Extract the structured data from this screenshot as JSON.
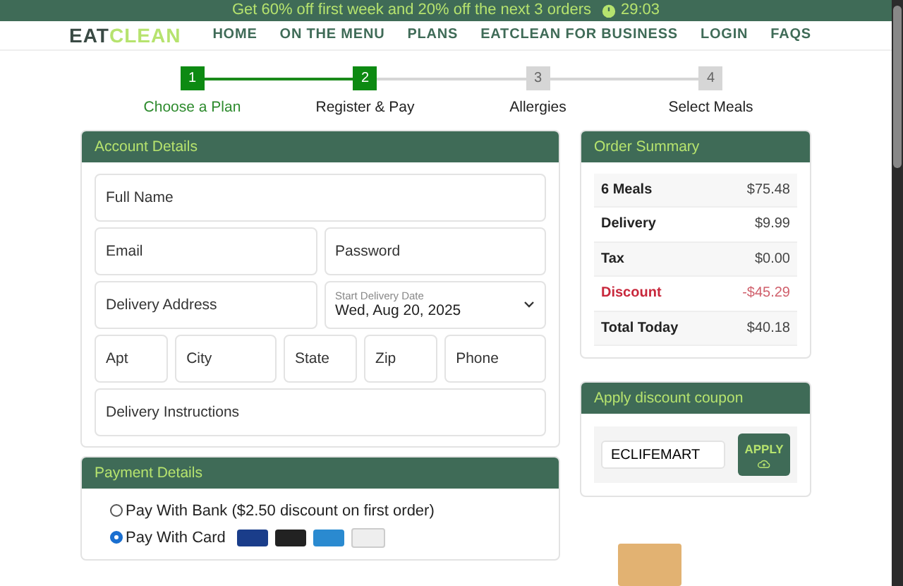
{
  "banner": {
    "text": "Get 60% off first week and 20% off the next 3 orders",
    "timer": "29:03"
  },
  "nav": {
    "logo_dark": "EAT",
    "logo_light": "CLEAN",
    "items": [
      "HOME",
      "ON THE MENU",
      "PLANS",
      "EATCLEAN FOR BUSINESS",
      "LOGIN",
      "FAQS"
    ]
  },
  "steps": [
    {
      "number": "1",
      "label": "Choose a Plan",
      "reached": true,
      "completed": true
    },
    {
      "number": "2",
      "label": "Register & Pay",
      "reached": true,
      "completed": false
    },
    {
      "number": "3",
      "label": "Allergies",
      "reached": false,
      "completed": false
    },
    {
      "number": "4",
      "label": "Select Meals",
      "reached": false,
      "completed": false
    }
  ],
  "account": {
    "title": "Account Details",
    "rows": [
      [
        {
          "kind": "text",
          "placeholder": "Full Name"
        }
      ],
      [
        {
          "kind": "text",
          "placeholder": "Email"
        },
        {
          "kind": "text",
          "placeholder": "Password"
        }
      ],
      [
        {
          "kind": "text",
          "placeholder": "Delivery Address"
        },
        {
          "kind": "select",
          "label": "Start Delivery Date",
          "value": "Wed, Aug 20, 2025"
        }
      ],
      [
        {
          "kind": "text",
          "placeholder": "Apt"
        },
        {
          "kind": "text",
          "placeholder": "City"
        },
        {
          "kind": "text",
          "placeholder": "State"
        },
        {
          "kind": "text",
          "placeholder": "Zip"
        },
        {
          "kind": "text",
          "placeholder": "Phone"
        }
      ],
      [
        {
          "kind": "text",
          "placeholder": "Delivery Instructions"
        }
      ]
    ]
  },
  "payment": {
    "title": "Payment Details",
    "options": [
      {
        "label": "Pay With Bank ($2.50 discount on first order)",
        "selected": false
      },
      {
        "label": "Pay With Card",
        "selected": true
      }
    ]
  },
  "summary": {
    "title": "Order Summary",
    "rows": [
      {
        "label": "6 Meals",
        "amount": "$75.48",
        "kind": "normal"
      },
      {
        "label": "Delivery",
        "amount": "$9.99",
        "kind": "normal"
      },
      {
        "label": "Tax",
        "amount": "$0.00",
        "kind": "normal"
      },
      {
        "label": "Discount",
        "amount": "-$45.29",
        "kind": "discount"
      },
      {
        "label": "Total Today",
        "amount": "$40.18",
        "kind": "normal"
      }
    ]
  },
  "coupon": {
    "title": "Apply discount coupon",
    "value": "ECLIFEMART",
    "button": "APPLY"
  }
}
